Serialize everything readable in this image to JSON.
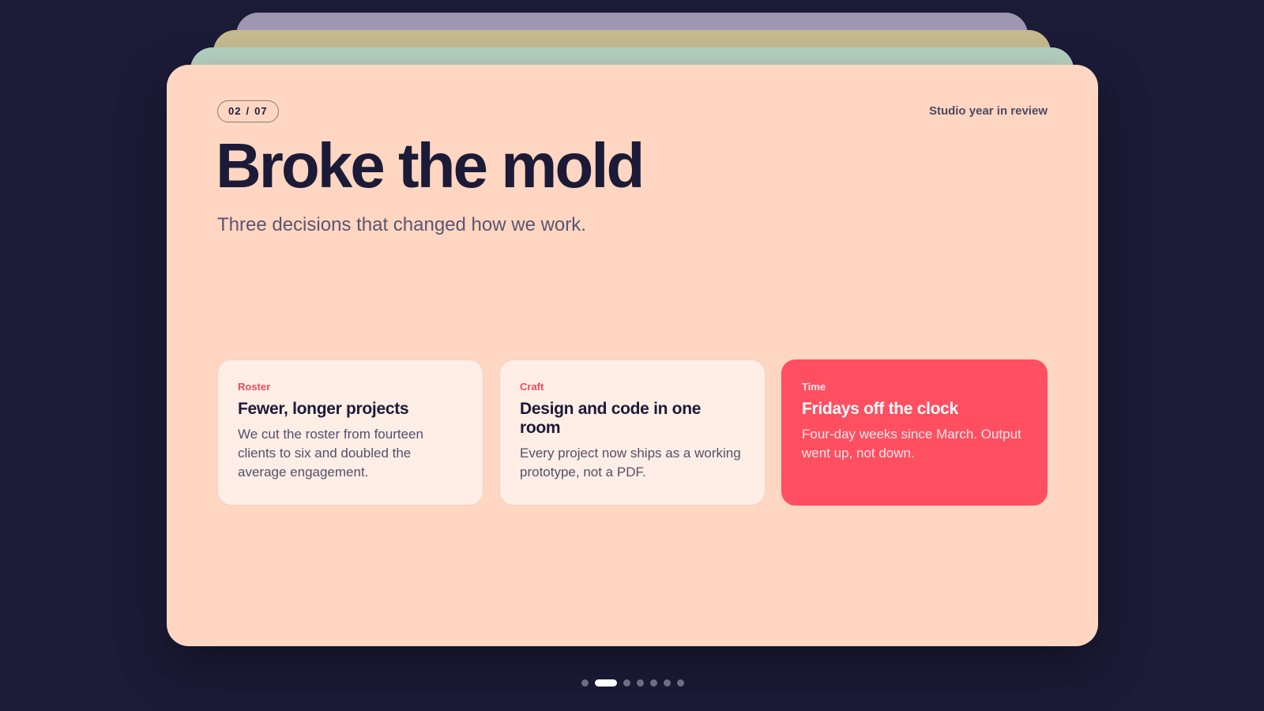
{
  "deck": {
    "label": "Studio year in review",
    "counter": {
      "current": "02",
      "separator": "/",
      "total": "07"
    }
  },
  "slide": {
    "title": "Broke the mold",
    "subtitle": "Three decisions that changed how we work.",
    "panels": [
      {
        "tag": "Roster",
        "title": "Fewer, longer projects",
        "body": "We cut the roster from fourteen clients to six and doubled the average engagement."
      },
      {
        "tag": "Craft",
        "title": "Design and code in one room",
        "body": "Every project now ships as a working prototype, not a PDF."
      },
      {
        "tag": "Time",
        "title": "Fridays off the clock",
        "body": "Four-day weeks since March. Output went up, not down."
      }
    ]
  },
  "pager": {
    "count": 7,
    "active_index": 1
  },
  "colors": {
    "background": "#1b1b38",
    "card": "#ffd6c2",
    "accent": "#ff4f61",
    "stack_back": [
      "#9d97b1",
      "#c5b98e",
      "#b6d1c1"
    ]
  }
}
